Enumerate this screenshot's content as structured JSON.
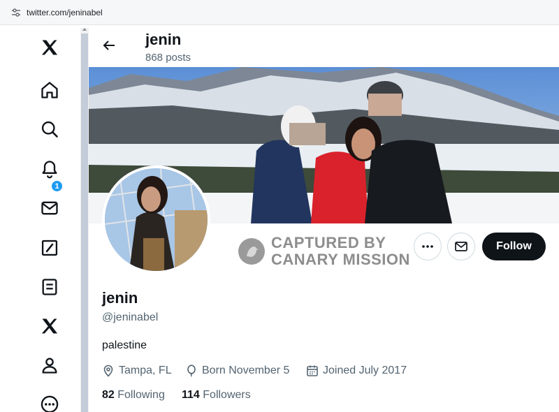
{
  "browser": {
    "url": "twitter.com/jeninabel"
  },
  "nav": {
    "items": [
      {
        "name": "x-logo-icon"
      },
      {
        "name": "home-icon"
      },
      {
        "name": "search-icon"
      },
      {
        "name": "notifications-icon"
      },
      {
        "name": "messages-icon"
      },
      {
        "name": "grok-icon"
      },
      {
        "name": "lists-icon"
      },
      {
        "name": "premium-x-icon"
      },
      {
        "name": "profile-icon"
      },
      {
        "name": "more-icon"
      }
    ],
    "notification_count": "1"
  },
  "header": {
    "name": "jenin",
    "posts": "868 posts"
  },
  "watermark": {
    "line1": "CAPTURED BY",
    "line2": "CANARY MISSION"
  },
  "actions": {
    "more_icon": "more-horizontal-icon",
    "message_icon": "envelope-icon",
    "follow_label": "Follow"
  },
  "profile": {
    "name": "jenin",
    "handle": "@jeninabel",
    "bio": "palestine",
    "location": "Tampa, FL",
    "born": "Born November 5",
    "joined": "Joined July 2017",
    "following_count": "82",
    "following_label": "Following",
    "followers_count": "114",
    "followers_label": "Followers"
  },
  "colors": {
    "accent": "#1d9bf0",
    "text": "#0f1419",
    "secondary": "#536471",
    "follow_bg": "#0f1419"
  }
}
